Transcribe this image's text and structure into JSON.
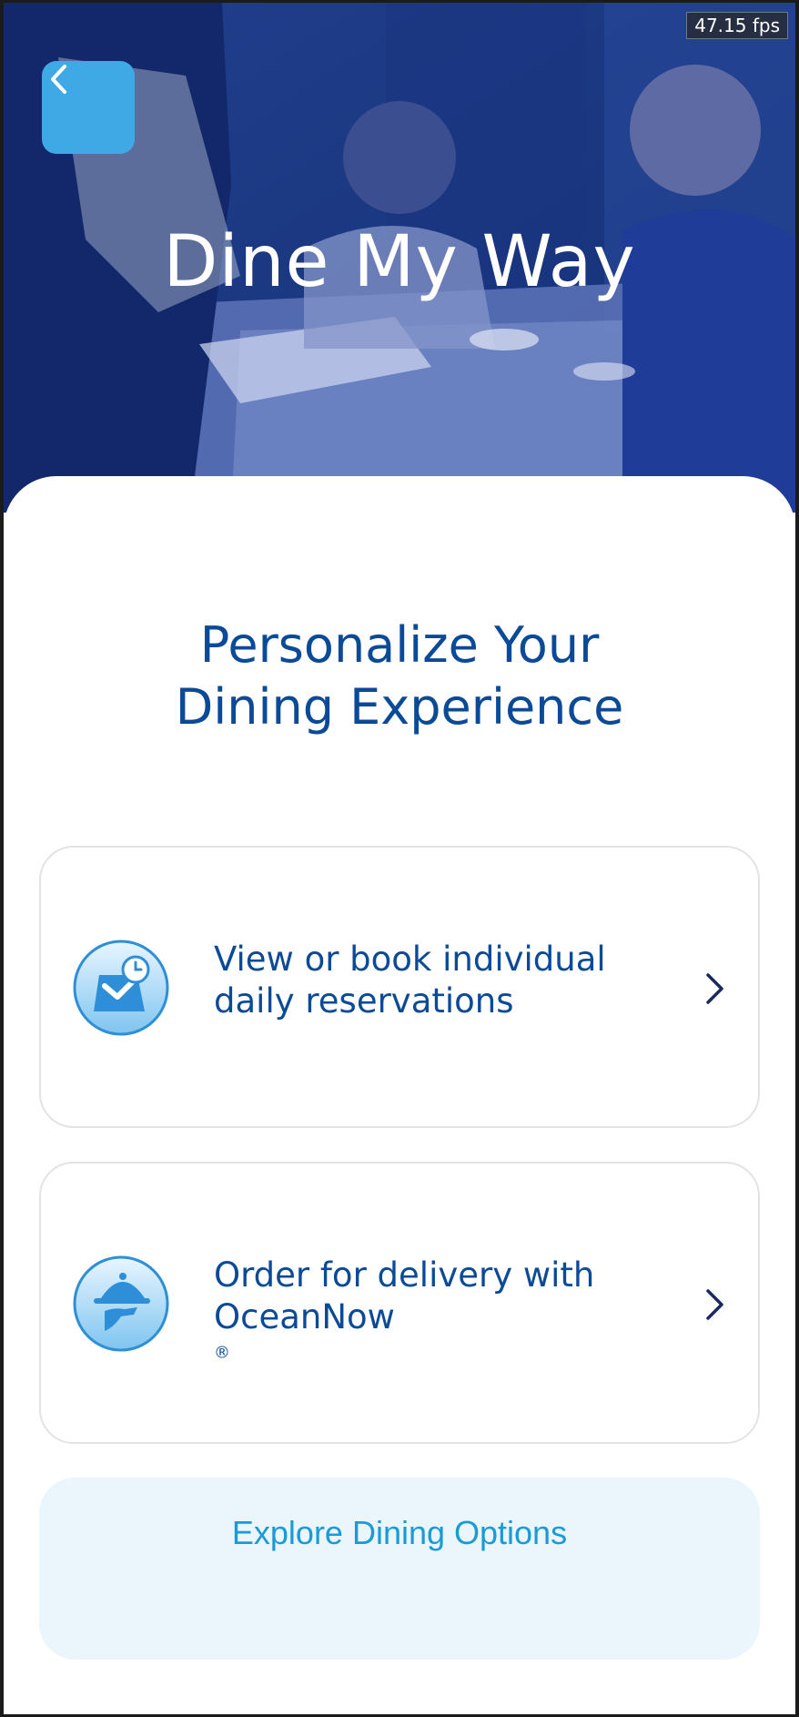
{
  "status": {
    "fps": "47.15 fps"
  },
  "hero": {
    "title": "Dine My Way"
  },
  "main": {
    "heading_line1": "Personalize Your",
    "heading_line2": "Dining Experience",
    "options": [
      {
        "line1": "View or book individual",
        "line2": "daily reservations",
        "icon": "reservation-calendar-icon"
      },
      {
        "line1": "Order for delivery with",
        "line2": "OceanNow",
        "reg": "®",
        "icon": "cloche-delivery-icon"
      }
    ],
    "explore_label": "Explore Dining Options"
  },
  "colors": {
    "brand_blue": "#0b4a97",
    "accent_light_blue": "#3fa9e6",
    "link_blue": "#1a9ad6",
    "explore_bg": "#eaf5fc"
  }
}
